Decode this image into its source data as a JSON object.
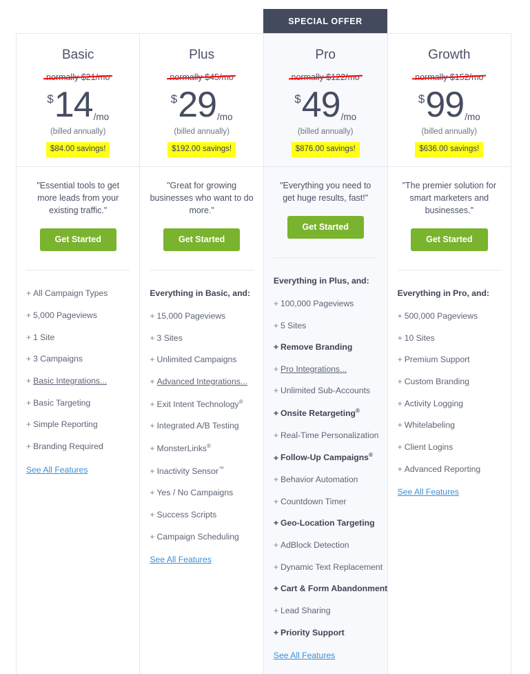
{
  "ribbon": {
    "label": "SPECIAL OFFER"
  },
  "labels": {
    "currency_symbol": "$",
    "per_month": "/mo",
    "billed": "(billed annually)",
    "cta": "Get Started",
    "see_all": "See All Features"
  },
  "colors": {
    "ribbon_bg": "#434a5e",
    "cta_green": "#7ab32e",
    "savings_yellow": "#ffff14",
    "strike_red": "#ff0000",
    "link_blue": "#3b8fd8",
    "featured_bg": "#f7f9fc",
    "border": "#e6e8ee"
  },
  "plans": [
    {
      "name": "Basic",
      "normally": "normally $21/mo",
      "price": "14",
      "savings": "$84.00 savings!",
      "quote": "\"Essential tools to get more leads from your existing traffic.\"",
      "featured": false,
      "everything": "",
      "features": [
        {
          "text": "All Campaign Types",
          "bold": false,
          "link": false,
          "sup": ""
        },
        {
          "text": "5,000 Pageviews",
          "bold": false,
          "link": false,
          "sup": ""
        },
        {
          "text": "1 Site",
          "bold": false,
          "link": false,
          "sup": ""
        },
        {
          "text": "3 Campaigns",
          "bold": false,
          "link": false,
          "sup": ""
        },
        {
          "text": "Basic Integrations...",
          "bold": false,
          "link": true,
          "sup": ""
        },
        {
          "text": "Basic Targeting",
          "bold": false,
          "link": false,
          "sup": ""
        },
        {
          "text": "Simple Reporting",
          "bold": false,
          "link": false,
          "sup": ""
        },
        {
          "text": "Branding Required",
          "bold": false,
          "link": false,
          "sup": ""
        }
      ]
    },
    {
      "name": "Plus",
      "normally": "normally $45/mo",
      "price": "29",
      "savings": "$192.00 savings!",
      "quote": "\"Great for growing businesses who want to do more.\"",
      "featured": false,
      "everything": "Everything in Basic, and:",
      "features": [
        {
          "text": "15,000 Pageviews",
          "bold": false,
          "link": false,
          "sup": ""
        },
        {
          "text": "3 Sites",
          "bold": false,
          "link": false,
          "sup": ""
        },
        {
          "text": "Unlimited Campaigns",
          "bold": false,
          "link": false,
          "sup": ""
        },
        {
          "text": "Advanced Integrations...",
          "bold": false,
          "link": true,
          "sup": ""
        },
        {
          "text": "Exit Intent Technology",
          "bold": false,
          "link": false,
          "sup": "®"
        },
        {
          "text": "Integrated A/B Testing",
          "bold": false,
          "link": false,
          "sup": ""
        },
        {
          "text": "MonsterLinks",
          "bold": false,
          "link": false,
          "sup": "®"
        },
        {
          "text": "Inactivity Sensor",
          "bold": false,
          "link": false,
          "sup": "™"
        },
        {
          "text": "Yes / No Campaigns",
          "bold": false,
          "link": false,
          "sup": ""
        },
        {
          "text": "Success Scripts",
          "bold": false,
          "link": false,
          "sup": ""
        },
        {
          "text": "Campaign Scheduling",
          "bold": false,
          "link": false,
          "sup": ""
        }
      ]
    },
    {
      "name": "Pro",
      "normally": "normally $122/mo",
      "price": "49",
      "savings": "$876.00 savings!",
      "quote": "\"Everything you need to get huge results, fast!\"",
      "featured": true,
      "everything": "Everything in Plus, and:",
      "features": [
        {
          "text": "100,000 Pageviews",
          "bold": false,
          "link": false,
          "sup": ""
        },
        {
          "text": "5 Sites",
          "bold": false,
          "link": false,
          "sup": ""
        },
        {
          "text": "Remove Branding",
          "bold": true,
          "link": false,
          "sup": ""
        },
        {
          "text": "Pro Integrations...",
          "bold": false,
          "link": true,
          "sup": ""
        },
        {
          "text": "Unlimited Sub-Accounts",
          "bold": false,
          "link": false,
          "sup": ""
        },
        {
          "text": "Onsite Retargeting",
          "bold": true,
          "link": false,
          "sup": "®"
        },
        {
          "text": "Real-Time Personalization",
          "bold": false,
          "link": false,
          "sup": ""
        },
        {
          "text": "Follow-Up Campaigns",
          "bold": true,
          "link": false,
          "sup": "®"
        },
        {
          "text": "Behavior Automation",
          "bold": false,
          "link": false,
          "sup": ""
        },
        {
          "text": "Countdown Timer",
          "bold": false,
          "link": false,
          "sup": ""
        },
        {
          "text": "Geo-Location Targeting",
          "bold": true,
          "link": false,
          "sup": ""
        },
        {
          "text": "AdBlock Detection",
          "bold": false,
          "link": false,
          "sup": ""
        },
        {
          "text": "Dynamic Text Replacement",
          "bold": false,
          "link": false,
          "sup": ""
        },
        {
          "text": "Cart & Form Abandonment",
          "bold": true,
          "link": false,
          "sup": ""
        },
        {
          "text": "Lead Sharing",
          "bold": false,
          "link": false,
          "sup": ""
        },
        {
          "text": "Priority Support",
          "bold": true,
          "link": false,
          "sup": ""
        }
      ]
    },
    {
      "name": "Growth",
      "normally": "normally $152/mo",
      "price": "99",
      "savings": "$636.00 savings!",
      "quote": "\"The premier solution for smart marketers and businesses.\"",
      "featured": false,
      "everything": "Everything in Pro, and:",
      "features": [
        {
          "text": "500,000 Pageviews",
          "bold": false,
          "link": false,
          "sup": ""
        },
        {
          "text": "10 Sites",
          "bold": false,
          "link": false,
          "sup": ""
        },
        {
          "text": "Premium Support",
          "bold": false,
          "link": false,
          "sup": ""
        },
        {
          "text": "Custom Branding",
          "bold": false,
          "link": false,
          "sup": ""
        },
        {
          "text": "Activity Logging",
          "bold": false,
          "link": false,
          "sup": ""
        },
        {
          "text": "Whitelabeling",
          "bold": false,
          "link": false,
          "sup": ""
        },
        {
          "text": "Client Logins",
          "bold": false,
          "link": false,
          "sup": ""
        },
        {
          "text": "Advanced Reporting",
          "bold": false,
          "link": false,
          "sup": ""
        }
      ]
    }
  ]
}
